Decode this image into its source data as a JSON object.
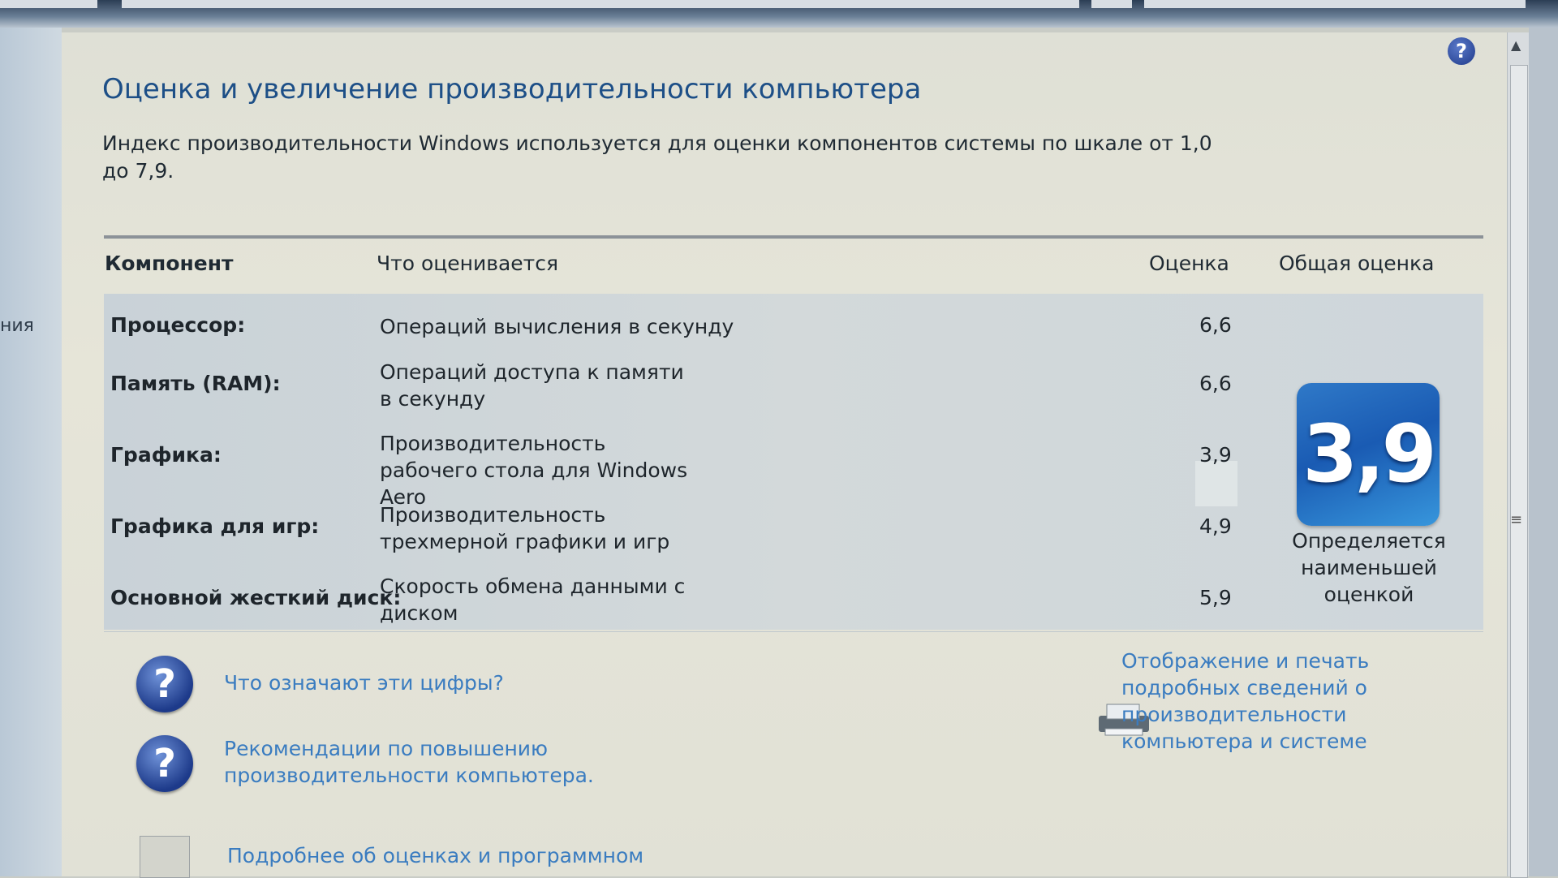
{
  "window": {
    "help_glyph": "?"
  },
  "left_nav": {
    "partial_text": "ния"
  },
  "page": {
    "title": "Оценка и увеличение производительности компьютера",
    "description": "Индекс производительности Windows используется для оценки компонентов системы по шкале от 1,0 до 7,9."
  },
  "table": {
    "headers": {
      "component": "Компонент",
      "what": "Что оценивается",
      "score": "Оценка",
      "overall": "Общая оценка"
    },
    "rows": [
      {
        "component": "Процессор:",
        "what": "Операций вычисления в секунду",
        "score": "6,6"
      },
      {
        "component": "Память (RAM):",
        "what": "Операций доступа к памяти в секунду",
        "score": "6,6"
      },
      {
        "component": "Графика:",
        "what": "Производительность рабочего стола для Windows Aero",
        "score": "3,9"
      },
      {
        "component": "Графика для игр:",
        "what": "Производительность трехмерной графики и игр",
        "score": "4,9"
      },
      {
        "component": "Основной жесткий диск:",
        "what": "Скорость обмена данными с диском",
        "score": "5,9"
      }
    ],
    "overall_score": "3,9",
    "overall_caption": "Определяется наименьшей оценкой"
  },
  "links": {
    "what_numbers": "Что означают эти цифры?",
    "tips": "Рекомендации по повышению производительности компьютера.",
    "details": "Подробнее об оценках и программном",
    "print_details": "Отображение и печать подробных сведений о производительности компьютера и системе"
  },
  "icons": {
    "help": "question-circle-icon",
    "printer": "printer-icon",
    "doc": "document-icon"
  },
  "colors": {
    "title": "#1d4f87",
    "link": "#3a7cc0",
    "badge": "#1a5bb3"
  }
}
